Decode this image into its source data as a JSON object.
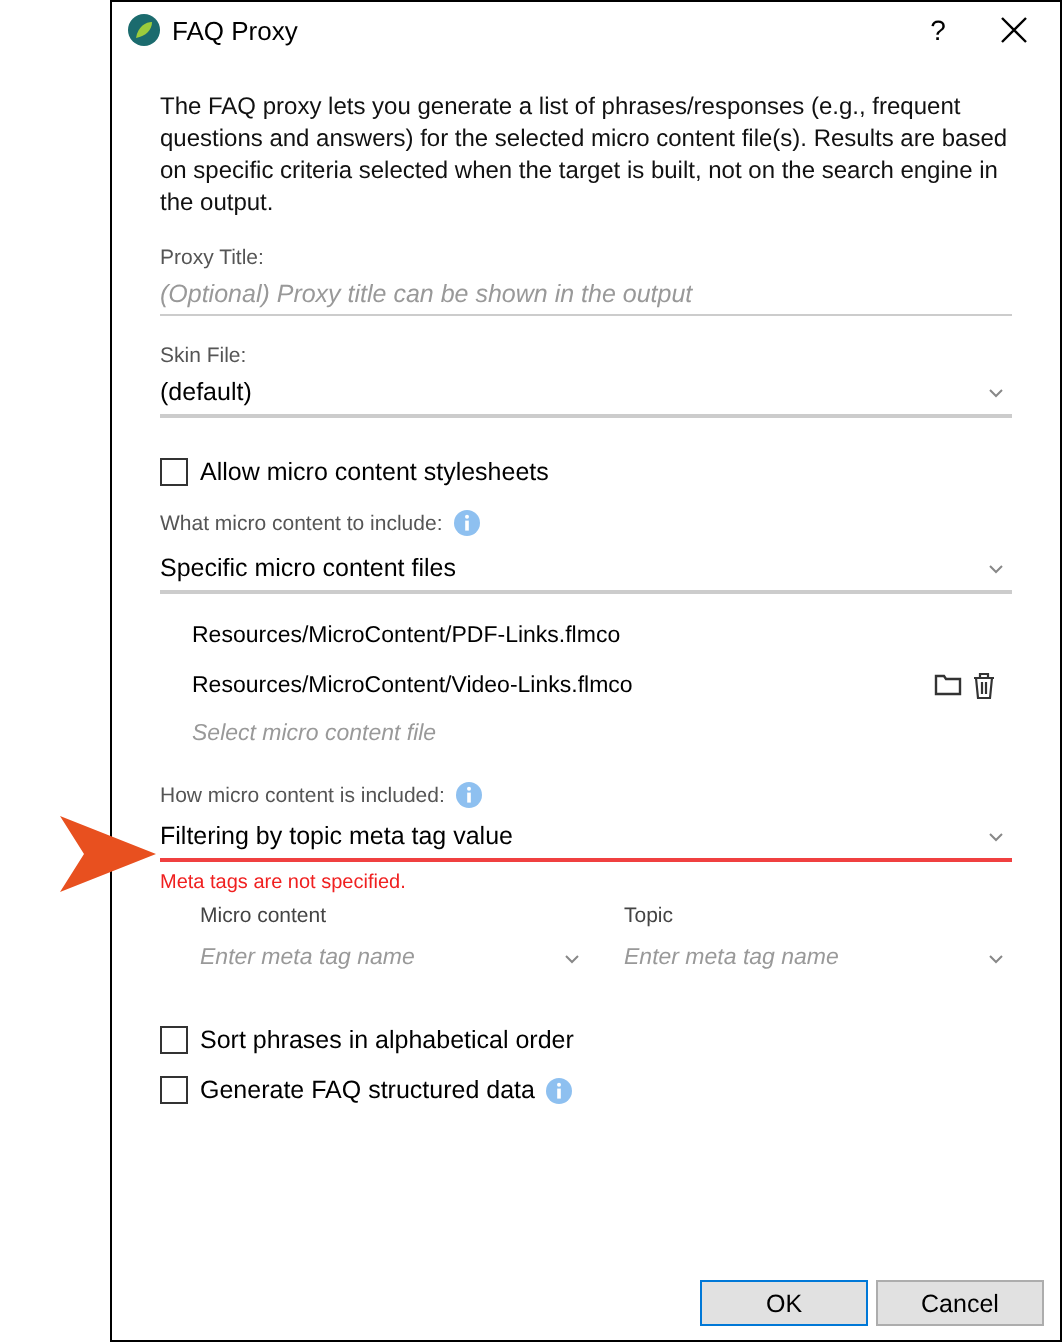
{
  "window": {
    "title": "FAQ Proxy",
    "help": "?"
  },
  "description": "The FAQ proxy lets you generate a list of phrases/responses (e.g., frequent questions and answers) for the selected micro content file(s). Results are based on specific criteria selected when the target is built, not on the search engine in the output.",
  "proxy_title": {
    "label": "Proxy Title:",
    "placeholder": "(Optional) Proxy title can be shown in the output"
  },
  "skin_file": {
    "label": "Skin File:",
    "value": "(default)"
  },
  "allow_stylesheets": {
    "label": "Allow micro content stylesheets",
    "checked": false
  },
  "content_to_include": {
    "label": "What micro content to include:",
    "value": "Specific micro content files"
  },
  "files": [
    {
      "path": "Resources/MicroContent/PDF-Links.flmco",
      "hovered": false
    },
    {
      "path": "Resources/MicroContent/Video-Links.flmco",
      "hovered": true
    }
  ],
  "file_picker": {
    "placeholder": "Select micro content file"
  },
  "inclusion_method": {
    "label": "How micro content is included:",
    "value": "Filtering by topic meta tag value",
    "invalid": true,
    "error": "Meta tags are not specified."
  },
  "meta_tags": [
    {
      "label": "Micro content",
      "placeholder": "Enter meta tag name"
    },
    {
      "label": "Topic",
      "placeholder": "Enter meta tag name"
    }
  ],
  "options": [
    {
      "label": "Sort phrases in alphabetical order",
      "checked": false,
      "info": false
    },
    {
      "label": "Generate FAQ structured data",
      "checked": false,
      "info": true
    }
  ],
  "buttons": [
    {
      "label": "OK",
      "default": true
    },
    {
      "label": "Cancel",
      "default": false
    }
  ]
}
